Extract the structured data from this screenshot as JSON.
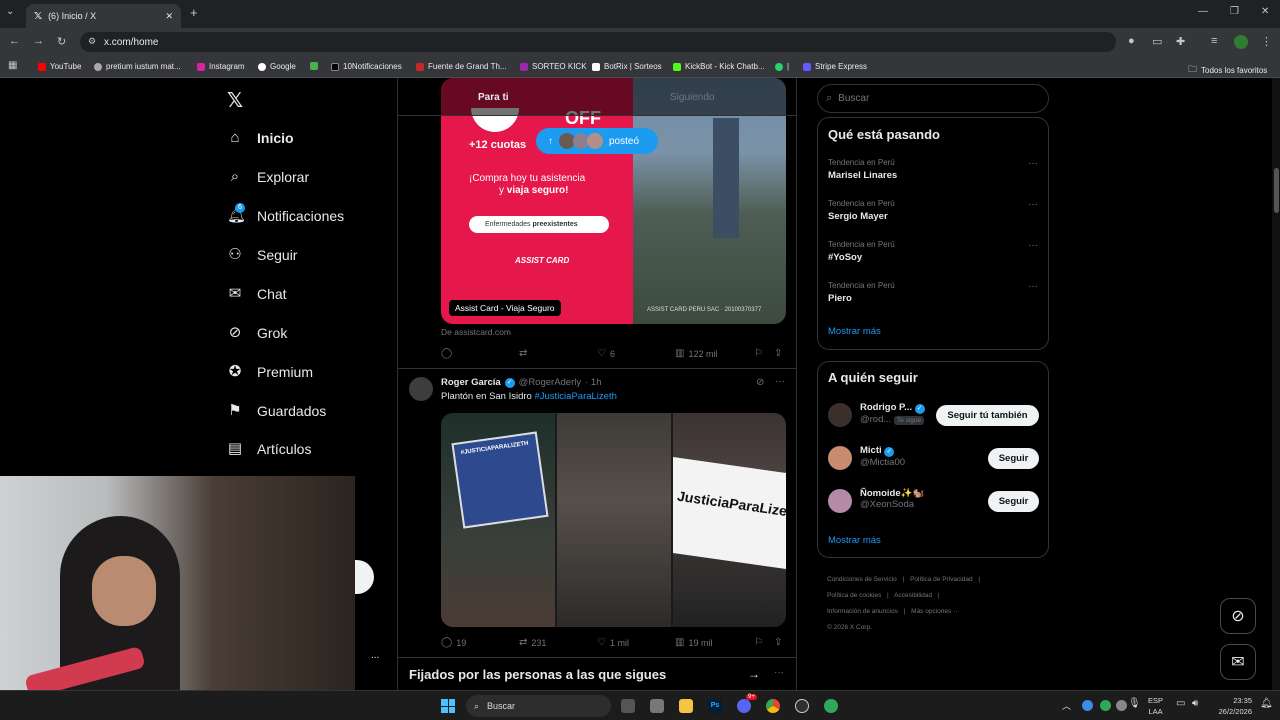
{
  "browser": {
    "tab_title": "(6) Inicio / X",
    "url": "x.com/home",
    "bookmarks": [
      "YouTube",
      "pretium iustum mat...",
      "Instagram",
      "Google",
      "10Notificaciones",
      "Fuente de Grand Th...",
      "SORTEO KICK",
      "BotRix | Sorteos",
      "KickBot - Kick Chatb...",
      "|",
      "Stripe Express"
    ],
    "bookmarks_folder": "Todos los favoritos"
  },
  "sidebar": {
    "items": [
      {
        "label": "Inicio",
        "icon": "home-icon"
      },
      {
        "label": "Explorar",
        "icon": "search-icon"
      },
      {
        "label": "Notificaciones",
        "icon": "bell-icon",
        "badge": "6"
      },
      {
        "label": "Seguir",
        "icon": "follow-icon"
      },
      {
        "label": "Chat",
        "icon": "mail-icon"
      },
      {
        "label": "Grok",
        "icon": "grok-icon"
      },
      {
        "label": "Premium",
        "icon": "premium-icon"
      },
      {
        "label": "Guardados",
        "icon": "bookmark-icon"
      },
      {
        "label": "Artículos",
        "icon": "articles-icon"
      }
    ],
    "more": "..."
  },
  "feed": {
    "tabs": [
      "Para ti",
      "Siguiendo"
    ],
    "new_posts": "posteó",
    "ad": {
      "off": "OFF",
      "cuotas": "+12 cuotas",
      "line1": "¡Compra hoy tu asistencia",
      "line2": "y",
      "line2b": "viaja seguro!",
      "pill": "Enfermedades",
      "pill_b": "preexistentes",
      "brand": "ASSIST CARD",
      "caption": "Assist Card - Viaja Seguro",
      "legal": "ASSIST CARD PERU SAC · 20100370377",
      "source": "De assistcard.com",
      "likes": "6",
      "views": "122 mil"
    },
    "post": {
      "author": "Roger García",
      "handle": "@RogerAderly",
      "time": "· 1h",
      "text": "Plantón en San Isidro",
      "hashtag": "#JusticiaParaLizeth",
      "banner1": "#JUSTICIAPARALIZETH",
      "banner2": "JusticiaParaLizeth",
      "replies": "19",
      "reposts": "231",
      "likes": "1 mil",
      "views": "19 mil"
    },
    "pinned_title": "Fijados por las personas a las que sigues"
  },
  "right": {
    "search_placeholder": "Buscar",
    "trends_title": "Qué está pasando",
    "trends": [
      {
        "context": "Tendencia en Perú",
        "name": "Marisel Linares"
      },
      {
        "context": "Tendencia en Perú",
        "name": "Sergio Mayer"
      },
      {
        "context": "Tendencia en Perú",
        "name": "#YoSoy"
      },
      {
        "context": "Tendencia en Perú",
        "name": "Piero"
      }
    ],
    "trends_more": "Mostrar más",
    "follow_title": "A quién seguir",
    "follow": [
      {
        "name": "Rodrigo P...",
        "handle": "@rod...",
        "tag": "Te sigue",
        "button": "Seguir tú también"
      },
      {
        "name": "Micti",
        "handle": "@Mictia00",
        "button": "Seguir"
      },
      {
        "name": "Ñomoide✨🐿️",
        "handle": "@XeonSoda",
        "button": "Seguir"
      }
    ],
    "follow_more": "Mostrar más",
    "footer": [
      "Condiciones de Servicio",
      "|",
      "Política de Privacidad",
      "|",
      "Política de cookies",
      "|",
      "Accesibilidad",
      "|",
      "Información de anuncios",
      "|",
      "Más opciones ···",
      "© 2026 X Corp."
    ]
  },
  "taskbar": {
    "search": "Buscar",
    "lang1": "ESP",
    "lang2": "LAA",
    "time": "23:35",
    "date": "26/2/2026",
    "discord_badge": "9+"
  },
  "colors": {
    "accent": "#1d9bf0",
    "brand_red": "#e5174b"
  }
}
